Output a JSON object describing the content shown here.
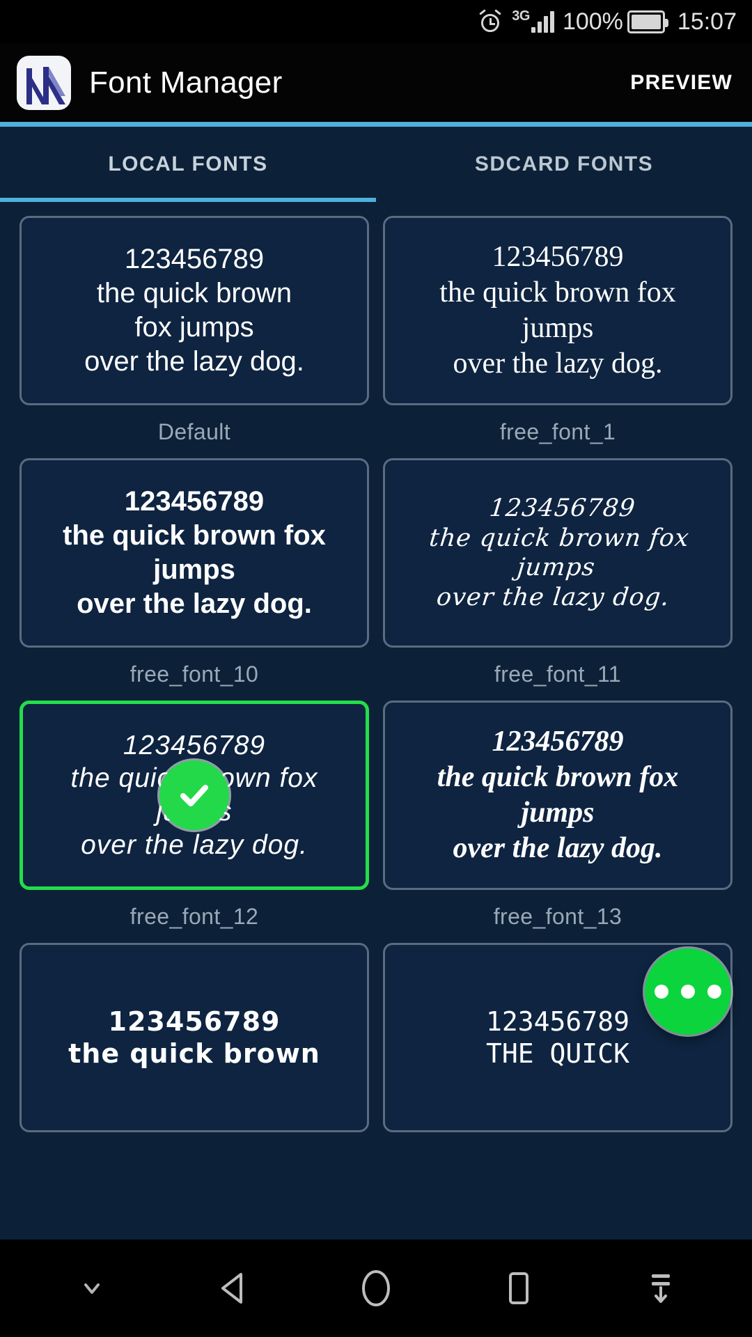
{
  "status_bar": {
    "alarm_icon": "alarm-clock-icon",
    "network_label": "3G",
    "signal_icon": "signal-bars-icon",
    "battery_percent": "100%",
    "battery_icon": "battery-full-icon",
    "time": "15:07"
  },
  "toolbar": {
    "logo_icon": "font-manager-logo-icon",
    "title": "Font Manager",
    "preview_label": "PREVIEW",
    "divider_color": "#4FB0DC"
  },
  "tabs": {
    "items": [
      {
        "label": "LOCAL FONTS",
        "active": true
      },
      {
        "label": "SDCARD FONTS",
        "active": false
      }
    ],
    "indicator_color": "#4FB0DC"
  },
  "sample_text": "123456789\nthe quick brown fox jumps\nover the lazy dog.",
  "selection": {
    "check_icon": "check-circle-icon",
    "border_color": "#24DD4B",
    "badge_color": "#23D94A"
  },
  "fab": {
    "icon": "more-horizontal-icon",
    "color": "#0BD43D"
  },
  "fonts": [
    {
      "name": "Default",
      "preview": "123456789\nthe quick brown\nfox jumps\nover the lazy dog.",
      "style": "f-default",
      "selected": false
    },
    {
      "name": "free_font_1",
      "preview": "123456789\nthe quick brown fox\njumps\nover the lazy dog.",
      "style": "f-serif",
      "selected": false
    },
    {
      "name": "free_font_10",
      "preview": "123456789\nthe quick brown fox\njumps\nover the lazy dog.",
      "style": "f-bold",
      "selected": false
    },
    {
      "name": "free_font_11",
      "preview": "123456789\nthe quick brown fox jumps\nover the lazy dog.",
      "style": "f-script",
      "selected": false
    },
    {
      "name": "free_font_12",
      "preview": "123456789\nthe quick brown fox\njumps\nover the lazy dog.",
      "style": "f-italic",
      "selected": true
    },
    {
      "name": "free_font_13",
      "preview": "123456789\nthe quick brown fox\njumps\nover the lazy dog.",
      "style": "f-serif-i",
      "selected": false
    },
    {
      "name": "",
      "preview": "123456789\nthe quick brown",
      "style": "f-rough",
      "selected": false
    },
    {
      "name": "",
      "preview": "123456789\nTHE QUICK",
      "style": "f-caps",
      "selected": false
    }
  ],
  "nav_bar": {
    "items": [
      {
        "icon": "chevron-down-icon"
      },
      {
        "icon": "back-triangle-icon"
      },
      {
        "icon": "home-circle-icon"
      },
      {
        "icon": "recents-square-icon"
      },
      {
        "icon": "pull-down-notifications-icon"
      }
    ]
  }
}
